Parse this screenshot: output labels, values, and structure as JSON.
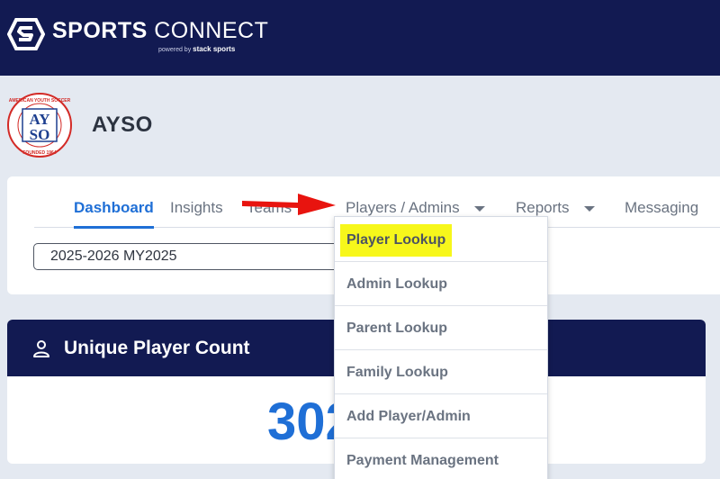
{
  "brand": {
    "name_bold": "SPORTS",
    "name_light": "CONNECT",
    "powered_by": "powered by",
    "powered_brand": "stack sports"
  },
  "organization": {
    "name": "AYSO",
    "logo_text": {
      "top": "AMERICAN YOUTH SOCCER ORGANIZATION",
      "letters_top": "AY",
      "letters_bottom": "SO",
      "bottom": "FOUNDED 1964"
    }
  },
  "nav": {
    "tabs": [
      {
        "label": "Dashboard",
        "active": true
      },
      {
        "label": "Insights"
      },
      {
        "label": "Teams"
      },
      {
        "label": "Players / Admins",
        "has_caret": true
      },
      {
        "label": "Reports",
        "has_caret": true
      },
      {
        "label": "Messaging"
      }
    ]
  },
  "season_select": {
    "value": "2025-2026 MY2025"
  },
  "players_menu": {
    "items": [
      {
        "label": "Player Lookup",
        "highlighted": true
      },
      {
        "label": "Admin Lookup"
      },
      {
        "label": "Parent Lookup"
      },
      {
        "label": "Family Lookup"
      },
      {
        "label": "Add Player/Admin"
      },
      {
        "label": "Payment Management"
      }
    ]
  },
  "unique_player_card": {
    "title": "Unique Player Count",
    "value_visible": "302"
  },
  "colors": {
    "header_navy": "#121a52",
    "accent_blue": "#1f6fd6",
    "highlight_yellow": "#f7f71b",
    "arrow_red": "#e8140f",
    "page_bg": "#e4e9f1"
  }
}
